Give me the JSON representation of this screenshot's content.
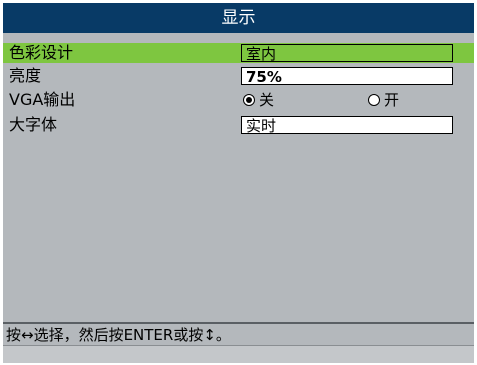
{
  "title": "显示",
  "rows": [
    {
      "label": "色彩设计",
      "value": "室内"
    },
    {
      "label": "亮度",
      "value": "75%"
    },
    {
      "label": "VGA输出",
      "options": [
        "关",
        "开"
      ],
      "selected": "关"
    },
    {
      "label": "大字体",
      "value": "实时"
    }
  ],
  "help": "按↔选择，然后按ENTER或按↕。",
  "colors": {
    "title_bg": "#083a66",
    "selected_bg": "#7ec640",
    "panel_bg": "#b4b8bc"
  }
}
